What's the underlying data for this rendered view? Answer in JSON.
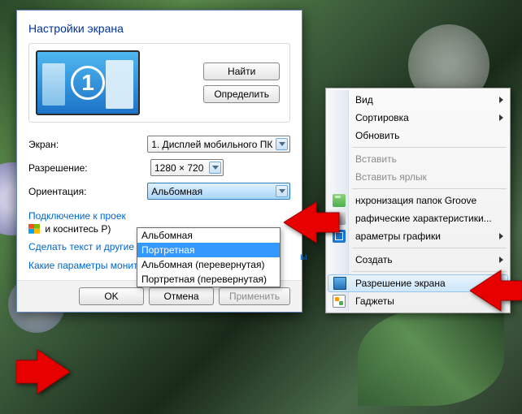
{
  "window": {
    "title": "Настройки экрана",
    "find_btn": "Найти",
    "identify_btn": "Определить"
  },
  "monitor_number": "1",
  "fields": {
    "screen_label": "Экран:",
    "screen_value": "1. Дисплей мобильного ПК",
    "resolution_label": "Разрешение:",
    "resolution_value": "1280 × 720",
    "orientation_label": "Ориентация:",
    "orientation_value": "Альбомная",
    "orientation_options": [
      "Альбомная",
      "Портретная",
      "Альбомная (перевернутая)",
      "Портретная (перевернутая)"
    ],
    "orientation_selected_index": 1
  },
  "links": {
    "project_part1": "Подключение к проек",
    "project_hidden_suffix": "ы",
    "project_tail": "и коснитесь P)",
    "make_text": "Сделать текст и другие элементы больше или меньше",
    "which_params": "Какие параметры монитора следует выбрать?"
  },
  "dialog": {
    "ok": "OK",
    "cancel": "Отмена",
    "apply": "Применить"
  },
  "context": {
    "view": "Вид",
    "sort": "Сортировка",
    "refresh": "Обновить",
    "paste": "Вставить",
    "paste_shortcut": "Вставить ярлык",
    "groove": "нхронизация папок Groove",
    "graphics": "рафические характеристики...",
    "graphics_params": "араметры графики",
    "create": "Создать",
    "resolution": "Разрешение экрана",
    "gadgets": "Гаджеты"
  }
}
